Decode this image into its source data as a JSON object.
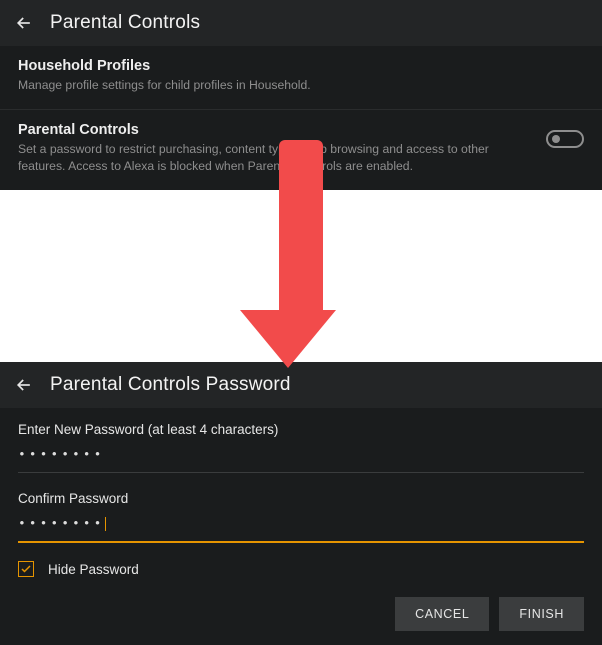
{
  "top": {
    "title": "Parental Controls",
    "household": {
      "title": "Household Profiles",
      "desc": "Manage profile settings for child profiles in Household."
    },
    "parental": {
      "title": "Parental Controls",
      "desc": "Set a password to restrict purchasing, content types, web browsing and access to other features. Access to Alexa is blocked when Parental Controls are enabled.",
      "toggle_on": false
    }
  },
  "bottom": {
    "title": "Parental Controls Password",
    "new_pw_label": "Enter New Password (at least 4 characters)",
    "new_pw_masked": "••••••••",
    "confirm_label": "Confirm Password",
    "confirm_masked": "••••••••",
    "hide_label": "Hide Password",
    "hide_checked": true,
    "cancel": "CANCEL",
    "finish": "FINISH"
  },
  "accent_color": "#e59400"
}
